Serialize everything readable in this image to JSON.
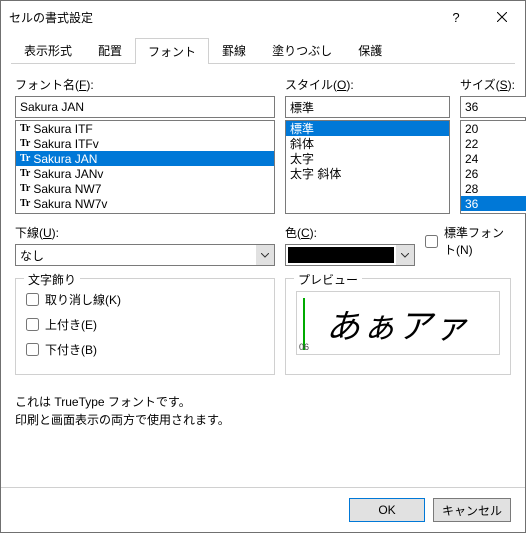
{
  "title": "セルの書式設定",
  "tabs": [
    "表示形式",
    "配置",
    "フォント",
    "罫線",
    "塗りつぶし",
    "保護"
  ],
  "active_tab": 2,
  "font_section": {
    "label_prefix": "フォント名(",
    "label_key": "F",
    "label_suffix": "):",
    "value": "Sakura JAN",
    "items": [
      "Sakura ITF",
      "Sakura ITFv",
      "Sakura JAN",
      "Sakura JANv",
      "Sakura NW7",
      "Sakura NW7v"
    ],
    "selected_index": 2
  },
  "style_section": {
    "label_prefix": "スタイル(",
    "label_key": "O",
    "label_suffix": "):",
    "value": "標準",
    "items": [
      "標準",
      "斜体",
      "太字",
      "太字 斜体"
    ],
    "selected_index": 0
  },
  "size_section": {
    "label_prefix": "サイズ(",
    "label_key": "S",
    "label_suffix": "):",
    "value": "36",
    "items": [
      "20",
      "22",
      "24",
      "26",
      "28",
      "36"
    ],
    "selected_index": 5
  },
  "underline": {
    "label_prefix": "下線(",
    "label_key": "U",
    "label_suffix": "):",
    "value": "なし"
  },
  "color": {
    "label_prefix": "色(",
    "label_key": "C",
    "label_suffix": "):",
    "value": "#000000"
  },
  "std_font": {
    "label_prefix": "標準フォント(",
    "label_key": "N",
    "label_suffix": ")"
  },
  "decoration": {
    "title": "文字飾り",
    "strike_prefix": "取り消し線(",
    "strike_key": "K",
    "strike_suffix": ")",
    "super_prefix": "上付き(",
    "super_key": "E",
    "super_suffix": ")",
    "sub_prefix": "下付き(",
    "sub_key": "B",
    "sub_suffix": ")"
  },
  "preview": {
    "title": "プレビュー",
    "badge": "06",
    "sample": "あぁアァ"
  },
  "info_line1": "これは TrueType フォントです。",
  "info_line2": "印刷と画面表示の両方で使用されます。",
  "buttons": {
    "ok": "OK",
    "cancel": "キャンセル"
  },
  "tt_prefix": "Tr"
}
